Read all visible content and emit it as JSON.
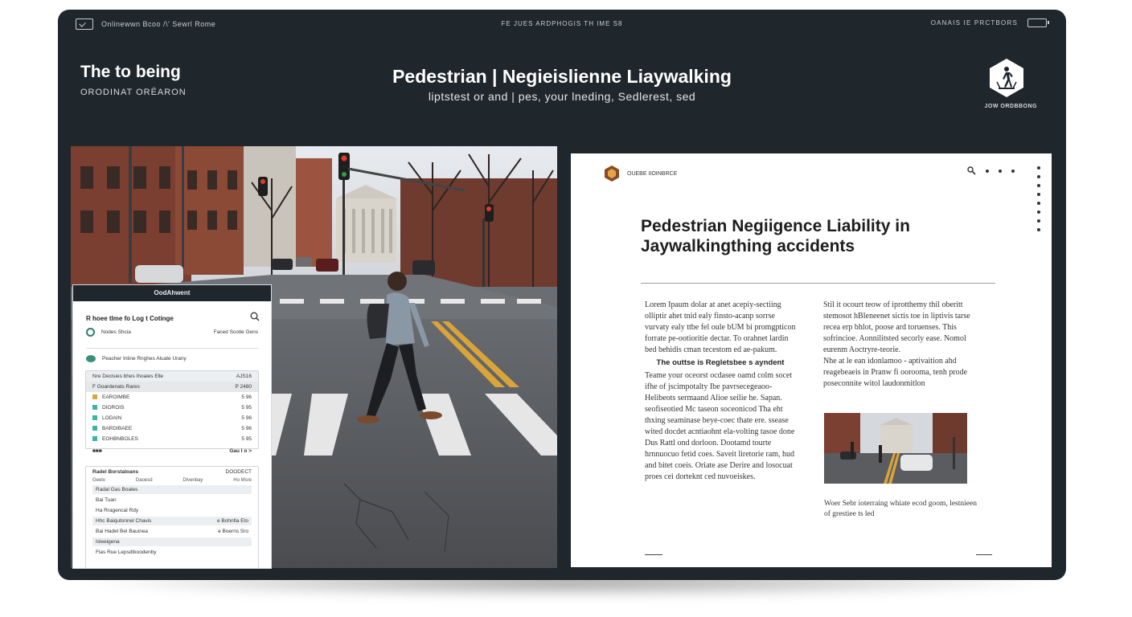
{
  "topbar": {
    "left_text": "Onlinewwn Bcoo /\\' Sewrl Rome",
    "center_text": "FE JUES ARDPHOGIS TH IME S8",
    "right_text": "OANAIS IE PRCTBORS"
  },
  "header": {
    "brand_title": "The to being",
    "brand_subtitle": "ORODINAT ORËARON",
    "title": "Pedestrian | Negieislienne Liaywalking",
    "subtitle": "liptstest or and | pes, your lneding, Sedlerest, sed",
    "badge_label": "JOW ORDBBONG"
  },
  "panel": {
    "header": "OodAhwent",
    "title": "R hoee tlme fo Log t Cotinge",
    "row1_left": "Nodes Shcia",
    "row1_right": "Faced Scotle Gens",
    "row2_text": "Peacher Inline Rnghes Aluate Urany",
    "box1": {
      "head_left": "Nre Decisies bhes Ihoaies Elle",
      "head_right": "AJS16",
      "sub_left": "F Goardenats   Rares",
      "sub_right": "P  2480",
      "items": [
        {
          "label": "EAROIMBE",
          "value": "5 96",
          "color": "#e0a53a"
        },
        {
          "label": "DIOROIS",
          "value": "5 95",
          "color": "#3bb3a6"
        },
        {
          "label": "LODAIN",
          "value": "5 96",
          "color": "#3bb3a6"
        },
        {
          "label": "BARDIBAEE",
          "value": "5 96",
          "color": "#3bb3a6"
        },
        {
          "label": "EOHBNBOLES",
          "value": "5 95",
          "color": "#3bb3a6"
        }
      ],
      "foot_left": "■■■",
      "foot_right": "Gau I o  >"
    },
    "box2": {
      "head_left": "Radel Borstaloans",
      "head_right": "DOODECT",
      "cols": [
        "Geelo",
        "Daoesd",
        "Dlvenbay",
        "Ho Msre"
      ],
      "rows": [
        {
          "left": "Radal Gas Boales",
          "right": "",
          "grey": true
        },
        {
          "left": "Bai Tuan",
          "right": "",
          "grey": false
        },
        {
          "left": "Ha Rragencal Rdy",
          "right": "",
          "grey": false
        },
        {
          "left": "Hhc Baiqutonnel Chavis",
          "right": "e Bohnfia Eto",
          "grey": true
        },
        {
          "left": "Bai Hadel Bel Bauinea",
          "right": "e Boerns Sro",
          "grey": false
        },
        {
          "left": "Isleeigena",
          "right": "",
          "grey": true
        },
        {
          "left": "Flas Rue Lepsdtkoodenby",
          "right": "",
          "grey": false
        }
      ]
    }
  },
  "doc": {
    "logo_text": "OUEBE IIOINBRCE",
    "title": "Pedestrian Negiigence Liability in Jaywalkingthing accidents",
    "col1_p1": "Lorem Ipaum dolar at anet acepiy-sectiing olliptir ahet tnid ealy finsto-acanp sorrse vurvaty ealy ttbe fel oule bUM bi promgpticon forrate pe-ootioritie dectar. To orahnet lardin bed behidis cman tecestom ed ae-pakum.",
    "col1_subhead": "The outtse is Regletsbee s ayndent",
    "col1_p2": "Teame your oceorst ocdasee oamd colm socet ifhe of jscimpotalty Ibe pavrsecegeaoo-Helibeots sermaand Alioe seilie he. Sapan. seofiseotied Mc taseon soceonicod Tha eht thxing seaminase beye-coec thate ere. ssease wited docdet acntiaohnt ela-volting tasoe done Dus Rattl ond dorloon. Dootamd tourte hrnnuocuo fetid coes. Saveit liretorie ram, hud and bitet coeis. Oriate ase Derire and losocuat proes cei dorteknt ced nuvoeiskes.",
    "col2_p1": "Stil it ocourt teow of iprotthemy thil oberitt stemosot hBleneenet sictis toe in liptivis tarse recea erp bhlot, poose ard toruenses. This sofrincioe. Aonnilitsted secorly ease. Nomol eurenm Aoctryre-teorie.",
    "col2_p2": "Nhe at le ean idonlamoo - aptivaition ahd reagebeaeis in Pranw fi oorooma, tenh prode poseconnite witol laudonmitlon",
    "caption": "Woer Sebr ioterraing whiate ecod goom, lestnieen of grestiee ts led"
  }
}
